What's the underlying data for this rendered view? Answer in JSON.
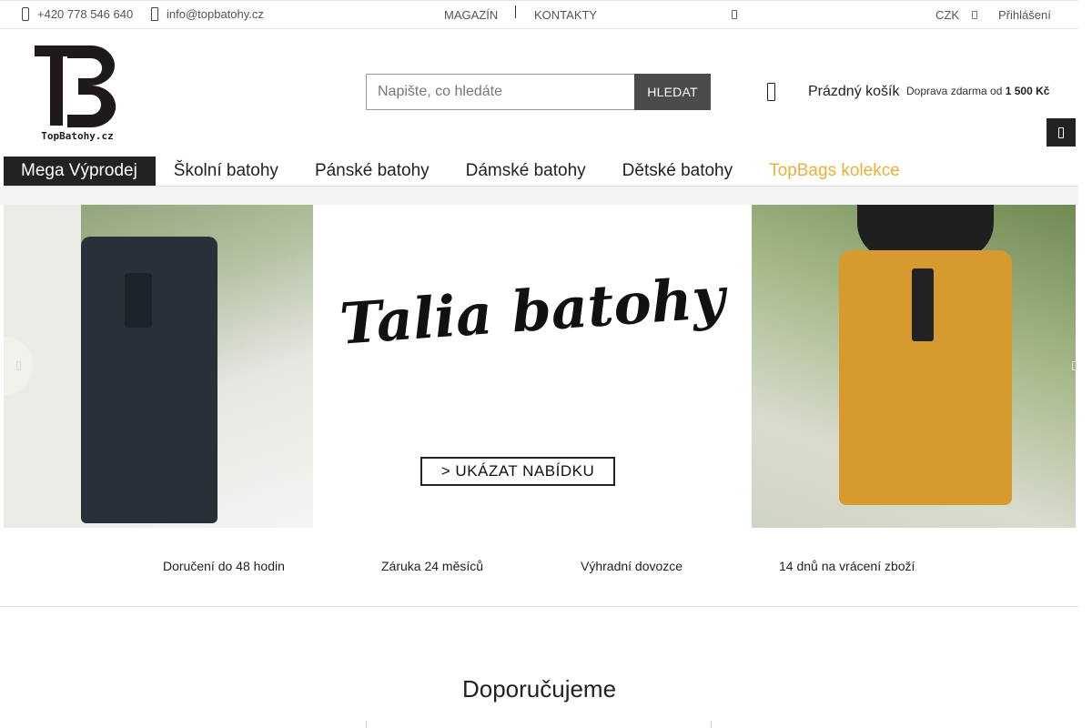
{
  "topbar": {
    "phone": "+420 778 546 640",
    "email": "info@topbatohy.cz",
    "links": [
      "MAGAZÍN",
      "KONTAKTY"
    ],
    "currency": "CZK",
    "login": "Přihlášení"
  },
  "header": {
    "logo_text": "TopBatohy.cz",
    "search_placeholder": "Napište, co hledáte",
    "search_button": "HLEDAT",
    "cart_label": "Prázdný košík",
    "shipping_text": "Doprava zdarma od",
    "shipping_amount": "1 500 Kč"
  },
  "nav": {
    "items": [
      "Mega Výprodej",
      "Školní batohy",
      "Pánské batohy",
      "Dámské batohy",
      "Dětské batohy",
      "TopBags kolekce"
    ]
  },
  "banner": {
    "title": "Talia batohy",
    "cta": "> UKÁZAT NABÍDKU"
  },
  "benefits": [
    "Doručení do 48 hodin",
    "Záruka 24 měsíců",
    "Výhradní dovozce",
    "14 dnů na vrácení zboží"
  ],
  "recommended": {
    "title": "Doporučujeme"
  },
  "colors": {
    "accent": "#e7b13b",
    "dark": "#222222",
    "button": "#4b4b4b"
  }
}
